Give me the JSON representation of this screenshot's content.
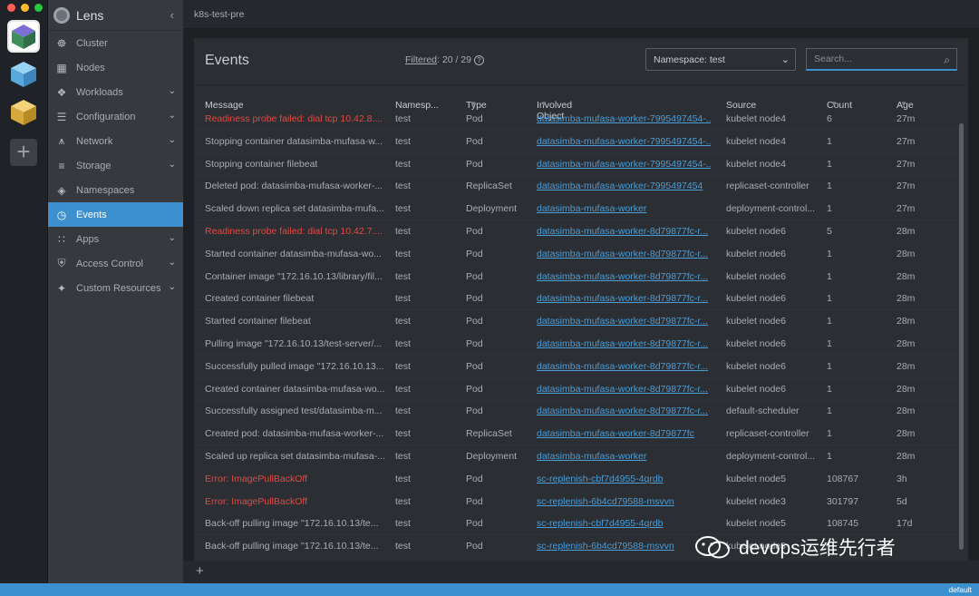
{
  "window": {
    "title": "Lens",
    "context": "k8s-test-pre"
  },
  "sidebar": {
    "items": [
      {
        "label": "Cluster",
        "icon": "helm-wheel-icon",
        "chevron": false,
        "active": false
      },
      {
        "label": "Nodes",
        "icon": "nodes-icon",
        "chevron": false,
        "active": false
      },
      {
        "label": "Workloads",
        "icon": "workloads-icon",
        "chevron": true,
        "active": false
      },
      {
        "label": "Configuration",
        "icon": "list-icon",
        "chevron": true,
        "active": false
      },
      {
        "label": "Network",
        "icon": "network-icon",
        "chevron": true,
        "active": false
      },
      {
        "label": "Storage",
        "icon": "database-icon",
        "chevron": true,
        "active": false
      },
      {
        "label": "Namespaces",
        "icon": "layers-icon",
        "chevron": false,
        "active": false
      },
      {
        "label": "Events",
        "icon": "clock-icon",
        "chevron": false,
        "active": true
      },
      {
        "label": "Apps",
        "icon": "grid-icon",
        "chevron": true,
        "active": false
      },
      {
        "label": "Access Control",
        "icon": "shield-icon",
        "chevron": true,
        "active": false
      },
      {
        "label": "Custom Resources",
        "icon": "puzzle-icon",
        "chevron": true,
        "active": false
      }
    ]
  },
  "events": {
    "title": "Events",
    "filtered_label": "Filtered",
    "filtered_value": ": 20 / 29",
    "namespace_select": "Namespace: test",
    "search_placeholder": "Search...",
    "columns": {
      "message": "Message",
      "namespace": "Namesp...",
      "type": "Type",
      "object": "Involved Object",
      "source": "Source",
      "count": "Count",
      "age": "Age"
    },
    "rows": [
      {
        "message": "Readiness probe failed: dial tcp 10.42.8....",
        "namespace": "test",
        "type": "Pod",
        "object": "datasimba-mufasa-worker-7995497454-...",
        "source": "kubelet node4",
        "count": "6",
        "age": "27m",
        "warn": true
      },
      {
        "message": "Stopping container datasimba-mufasa-w...",
        "namespace": "test",
        "type": "Pod",
        "object": "datasimba-mufasa-worker-7995497454-...",
        "source": "kubelet node4",
        "count": "1",
        "age": "27m",
        "warn": false
      },
      {
        "message": "Stopping container filebeat",
        "namespace": "test",
        "type": "Pod",
        "object": "datasimba-mufasa-worker-7995497454-...",
        "source": "kubelet node4",
        "count": "1",
        "age": "27m",
        "warn": false
      },
      {
        "message": "Deleted pod: datasimba-mufasa-worker-...",
        "namespace": "test",
        "type": "ReplicaSet",
        "object": "datasimba-mufasa-worker-7995497454",
        "source": "replicaset-controller",
        "count": "1",
        "age": "27m",
        "warn": false
      },
      {
        "message": "Scaled down replica set datasimba-mufa...",
        "namespace": "test",
        "type": "Deployment",
        "object": "datasimba-mufasa-worker",
        "source": "deployment-control...",
        "count": "1",
        "age": "27m",
        "warn": false
      },
      {
        "message": "Readiness probe failed: dial tcp 10.42.7....",
        "namespace": "test",
        "type": "Pod",
        "object": "datasimba-mufasa-worker-8d79877fc-r...",
        "source": "kubelet node6",
        "count": "5",
        "age": "28m",
        "warn": true
      },
      {
        "message": "Started container datasimba-mufasa-wo...",
        "namespace": "test",
        "type": "Pod",
        "object": "datasimba-mufasa-worker-8d79877fc-r...",
        "source": "kubelet node6",
        "count": "1",
        "age": "28m",
        "warn": false
      },
      {
        "message": "Container image \"172.16.10.13/library/fil...",
        "namespace": "test",
        "type": "Pod",
        "object": "datasimba-mufasa-worker-8d79877fc-r...",
        "source": "kubelet node6",
        "count": "1",
        "age": "28m",
        "warn": false
      },
      {
        "message": "Created container filebeat",
        "namespace": "test",
        "type": "Pod",
        "object": "datasimba-mufasa-worker-8d79877fc-r...",
        "source": "kubelet node6",
        "count": "1",
        "age": "28m",
        "warn": false
      },
      {
        "message": "Started container filebeat",
        "namespace": "test",
        "type": "Pod",
        "object": "datasimba-mufasa-worker-8d79877fc-r...",
        "source": "kubelet node6",
        "count": "1",
        "age": "28m",
        "warn": false
      },
      {
        "message": "Pulling image \"172.16.10.13/test-server/...",
        "namespace": "test",
        "type": "Pod",
        "object": "datasimba-mufasa-worker-8d79877fc-r...",
        "source": "kubelet node6",
        "count": "1",
        "age": "28m",
        "warn": false
      },
      {
        "message": "Successfully pulled image \"172.16.10.13...",
        "namespace": "test",
        "type": "Pod",
        "object": "datasimba-mufasa-worker-8d79877fc-r...",
        "source": "kubelet node6",
        "count": "1",
        "age": "28m",
        "warn": false
      },
      {
        "message": "Created container datasimba-mufasa-wo...",
        "namespace": "test",
        "type": "Pod",
        "object": "datasimba-mufasa-worker-8d79877fc-r...",
        "source": "kubelet node6",
        "count": "1",
        "age": "28m",
        "warn": false
      },
      {
        "message": "Successfully assigned test/datasimba-m...",
        "namespace": "test",
        "type": "Pod",
        "object": "datasimba-mufasa-worker-8d79877fc-r...",
        "source": "default-scheduler",
        "count": "1",
        "age": "28m",
        "warn": false
      },
      {
        "message": "Created pod: datasimba-mufasa-worker-...",
        "namespace": "test",
        "type": "ReplicaSet",
        "object": "datasimba-mufasa-worker-8d79877fc",
        "source": "replicaset-controller",
        "count": "1",
        "age": "28m",
        "warn": false
      },
      {
        "message": "Scaled up replica set datasimba-mufasa-...",
        "namespace": "test",
        "type": "Deployment",
        "object": "datasimba-mufasa-worker",
        "source": "deployment-control...",
        "count": "1",
        "age": "28m",
        "warn": false
      },
      {
        "message": "Error: ImagePullBackOff",
        "namespace": "test",
        "type": "Pod",
        "object": "sc-replenish-cbf7d4955-4qrdb",
        "source": "kubelet node5",
        "count": "108767",
        "age": "3h",
        "warn": true
      },
      {
        "message": "Error: ImagePullBackOff",
        "namespace": "test",
        "type": "Pod",
        "object": "sc-replenish-6b4cd79588-msvvn",
        "source": "kubelet node3",
        "count": "301797",
        "age": "5d",
        "warn": true
      },
      {
        "message": "Back-off pulling image \"172.16.10.13/te...",
        "namespace": "test",
        "type": "Pod",
        "object": "sc-replenish-cbf7d4955-4qrdb",
        "source": "kubelet node5",
        "count": "108745",
        "age": "17d",
        "warn": false
      },
      {
        "message": "Back-off pulling image \"172.16.10.13/te...",
        "namespace": "test",
        "type": "Pod",
        "object": "sc-replenish-6b4cd79588-msvvn",
        "source": "kubelet node3",
        "count": "",
        "age": "",
        "warn": false
      }
    ]
  },
  "statusbar": {
    "namespace": "default"
  },
  "watermark": {
    "text": "devops运维先行者"
  },
  "colors": {
    "accent": "#3d90ce",
    "warning": "#de4b45",
    "link": "#4d9dd6"
  }
}
